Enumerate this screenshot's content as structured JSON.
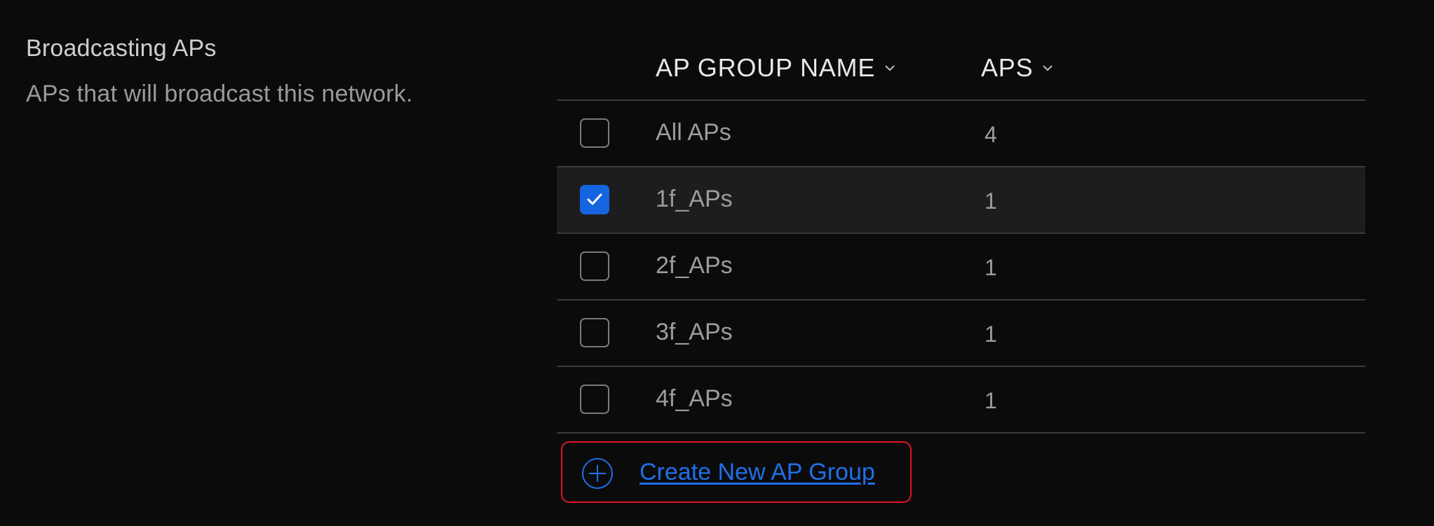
{
  "section": {
    "title": "Broadcasting APs",
    "description": "APs that will broadcast this network."
  },
  "table": {
    "columns": [
      {
        "label": "AP GROUP NAME",
        "icon": "chevron-down-icon"
      },
      {
        "label": "APS",
        "icon": "chevron-down-icon"
      }
    ],
    "rows": [
      {
        "name": "All APs",
        "aps": "4",
        "checked": false
      },
      {
        "name": "1f_APs",
        "aps": "1",
        "checked": true
      },
      {
        "name": "2f_APs",
        "aps": "1",
        "checked": false
      },
      {
        "name": "3f_APs",
        "aps": "1",
        "checked": false
      },
      {
        "name": "4f_APs",
        "aps": "1",
        "checked": false
      }
    ]
  },
  "create": {
    "label": "Create New AP Group",
    "icon": "plus-circle-icon"
  },
  "colors": {
    "background": "#0b0b0c",
    "accent": "#1565e0",
    "link": "#1f6fe8",
    "highlight_border": "#e0141e"
  }
}
